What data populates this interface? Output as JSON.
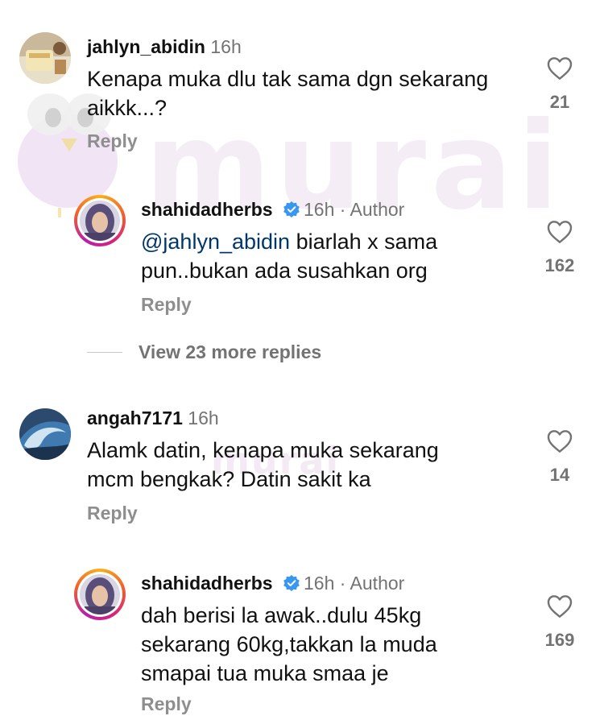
{
  "watermark": {
    "brand": "murai"
  },
  "comments": [
    {
      "username": "jahlyn_abidin",
      "time": "16h",
      "text_lines": [
        "Kenapa muka dlu tak sama dgn sekarang",
        "aikkk...?"
      ],
      "likes": "21",
      "reply_label": "Reply"
    },
    {
      "username": "shahidadherbs",
      "time": "16h",
      "author_tag": "Author",
      "mention": "@jahlyn_abidin",
      "text_lines": [
        "biarlah x sama",
        "pun..bukan ada susahkan org"
      ],
      "likes": "162",
      "reply_label": "Reply"
    },
    {
      "username": "angah7171",
      "time": "16h",
      "text_lines": [
        "Alamk datin, kenapa muka sekarang",
        "mcm bengkak? Datin sakit ka"
      ],
      "likes": "14",
      "reply_label": "Reply"
    },
    {
      "username": "shahidadherbs",
      "time": "16h",
      "author_tag": "Author",
      "text_lines": [
        "dah berisi la awak..dulu 45kg",
        "sekarang 60kg,takkan la muda",
        "smapai tua muka smaa je"
      ],
      "likes": "169",
      "reply_label": "Reply"
    }
  ],
  "view_more_replies": "View 23 more replies",
  "colors": {
    "text": "#111111",
    "meta": "#737373",
    "reply": "#8e8e8e",
    "mention": "#00376b",
    "verified": "#3897f0"
  },
  "icons": [
    "heart-icon",
    "verified-badge-icon"
  ]
}
